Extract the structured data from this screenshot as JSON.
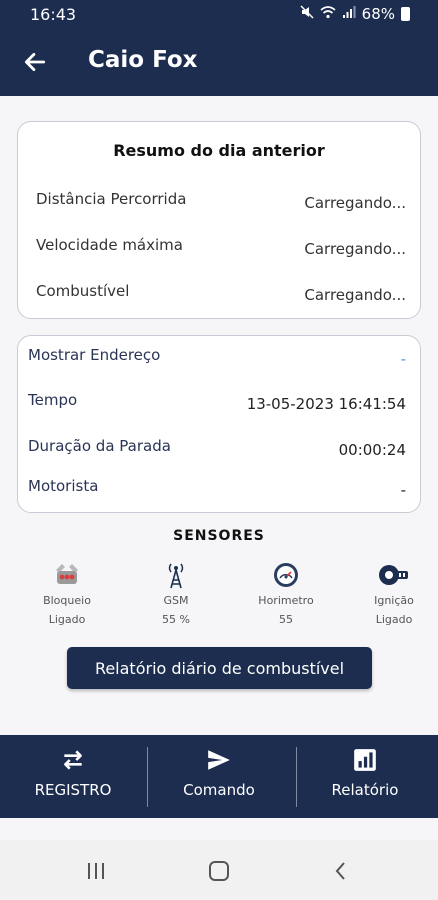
{
  "status_bar": {
    "time": "16:43",
    "battery": "68%"
  },
  "app_bar": {
    "title": "Caio Fox"
  },
  "summary": {
    "title": "Resumo do dia anterior",
    "rows": [
      {
        "label": "Distância Percorrida",
        "value": "Carregando..."
      },
      {
        "label": "Velocidade máxima",
        "value": "Carregando..."
      },
      {
        "label": "Combustível",
        "value": "Carregando..."
      }
    ]
  },
  "info": {
    "rows": [
      {
        "label": "Mostrar Endereço",
        "value": "-"
      },
      {
        "label": "Tempo",
        "value": "13-05-2023 16:41:54"
      },
      {
        "label": "Duração da Parada",
        "value": "00:00:24"
      },
      {
        "label": "Motorista",
        "value": "-"
      }
    ]
  },
  "sensors": {
    "title": "SENSORES",
    "items": [
      {
        "name": "Bloqueio",
        "value": "Ligado",
        "icon": "engine-block-icon"
      },
      {
        "name": "GSM",
        "value": "55 %",
        "icon": "antenna-icon"
      },
      {
        "name": "Horimetro",
        "value": "55",
        "icon": "gauge-icon"
      },
      {
        "name": "Ignição",
        "value": "Ligado",
        "icon": "ignition-icon"
      }
    ]
  },
  "fuel_report_button": "Relatório diário de combustível",
  "bottom_nav": [
    {
      "label": "REGISTRO",
      "icon": "swap-icon"
    },
    {
      "label": "Comando",
      "icon": "send-icon"
    },
    {
      "label": "Relatório",
      "icon": "bar-chart-icon"
    }
  ],
  "colors": {
    "primary": "#1c2d4f",
    "accent": "#5b8fd0",
    "border": "#c9cbd6"
  }
}
